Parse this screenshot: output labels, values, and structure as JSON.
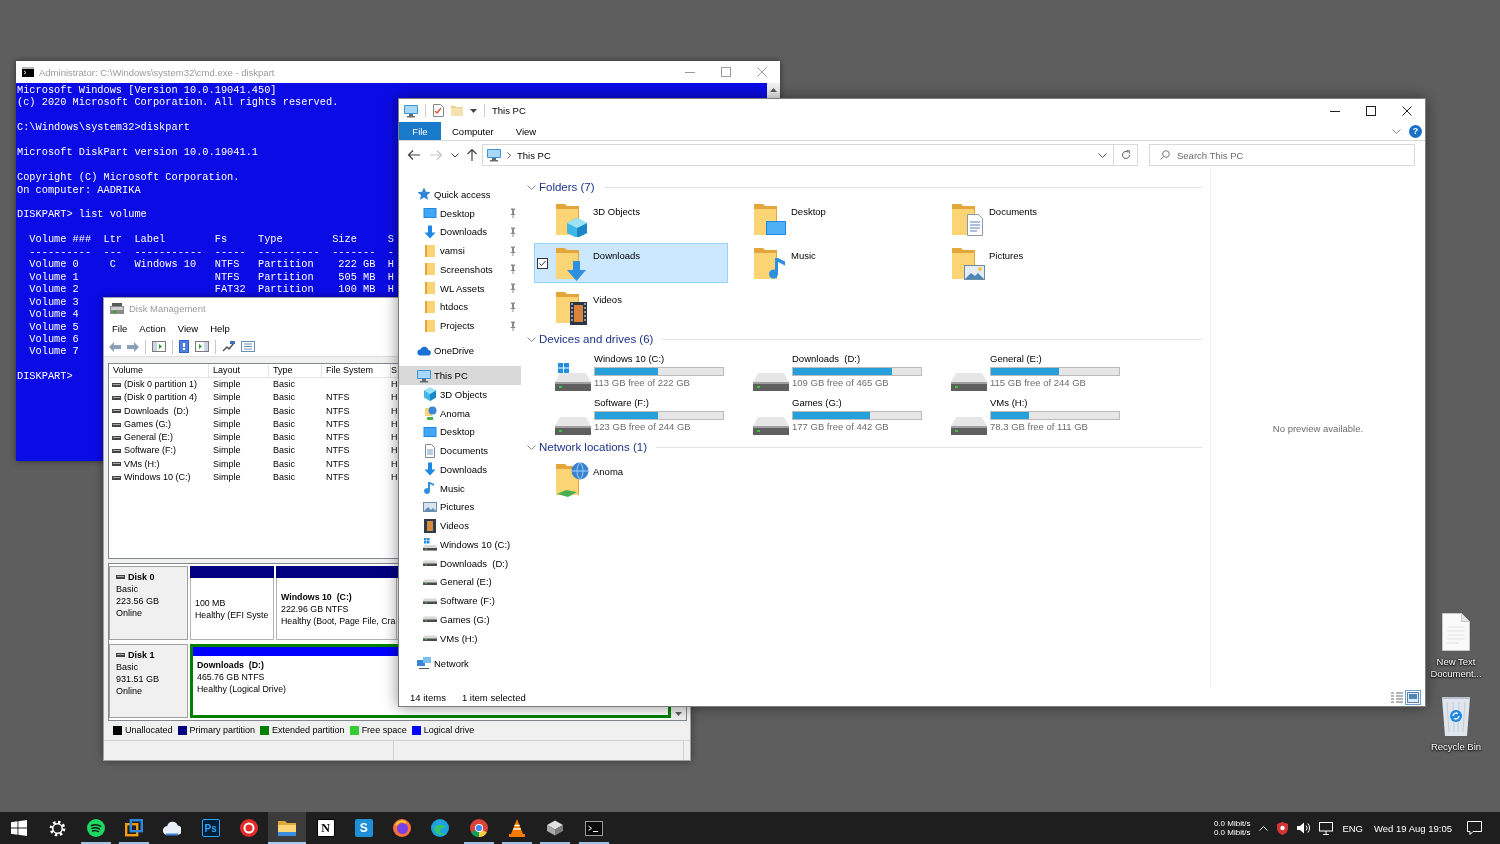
{
  "desktop": {
    "icons": [
      {
        "kind": "text-file",
        "label": "New Text Document..."
      },
      {
        "kind": "recycle-bin",
        "label": "Recycle Bin"
      }
    ]
  },
  "console_window": {
    "title": "Administrator: C:\\Windows\\system32\\cmd.exe - diskpart",
    "blocks": [
      [
        "Microsoft Windows [Version 10.0.19041.450]",
        "(c) 2020 Microsoft Corporation. All rights reserved."
      ],
      [
        "C:\\Windows\\system32>diskpart"
      ],
      [
        "Microsoft DiskPart version 10.0.19041.1"
      ],
      [
        "Copyright (C) Microsoft Corporation.",
        "On computer: AADRIKA"
      ],
      [
        "DISKPART> list volume"
      ],
      [
        "  Volume ###  Ltr  Label        Fs     Type        Size     S",
        "  ----------  ---  -----------  -----  ----------  -------  -",
        "  Volume 0     C   Windows 10   NTFS   Partition    222 GB  H",
        "  Volume 1                      NTFS   Partition    505 MB  H",
        "  Volume 2                      FAT32  Partition    100 MB  H",
        "  Volume 3",
        "  Volume 4",
        "  Volume 5",
        "  Volume 6",
        "  Volume 7"
      ],
      [
        "DISKPART>"
      ]
    ]
  },
  "disk_management": {
    "title": "Disk Management",
    "menu": [
      "File",
      "Action",
      "View",
      "Help"
    ],
    "volumes": {
      "columns": [
        "Volume",
        "Layout",
        "Type",
        "File System",
        "S"
      ],
      "rows": [
        {
          "volume": "(Disk 0 partition 1)",
          "layout": "Simple",
          "type": "Basic",
          "column_5": "H"
        },
        {
          "volume": "(Disk 0 partition 4)",
          "layout": "Simple",
          "type": "Basic",
          "file_system": "NTFS",
          "column_5": "H"
        },
        {
          "volume": "Downloads  (D:)",
          "layout": "Simple",
          "type": "Basic",
          "file_system": "NTFS",
          "column_5": "H"
        },
        {
          "volume": "Games (G:)",
          "layout": "Simple",
          "type": "Basic",
          "file_system": "NTFS",
          "column_5": "H"
        },
        {
          "volume": "General (E:)",
          "layout": "Simple",
          "type": "Basic",
          "file_system": "NTFS",
          "column_5": "H"
        },
        {
          "volume": "Software (F:)",
          "layout": "Simple",
          "type": "Basic",
          "file_system": "NTFS",
          "column_5": "H"
        },
        {
          "volume": "VMs (H:)",
          "layout": "Simple",
          "type": "Basic",
          "file_system": "NTFS",
          "column_5": "H"
        },
        {
          "volume": "Windows 10 (C:)",
          "layout": "Simple",
          "type": "Basic",
          "file_system": "NTFS",
          "column_5": "H"
        }
      ]
    },
    "disks": [
      {
        "name": "Disk 0",
        "type": "Basic",
        "size": "223.56 GB",
        "status": "Online",
        "partitions": [
          {
            "kind": "primary",
            "size": "100 MB",
            "status": "Healthy (EFI Syste"
          },
          {
            "kind": "primary",
            "name": "Windows 10  (C:)",
            "size": "222.96 GB NTFS",
            "status": "Healthy (Boot, Page File, Cra"
          }
        ]
      },
      {
        "name": "Disk 1",
        "type": "Basic",
        "size": "931.51 GB",
        "status": "Online",
        "partitions": [
          {
            "kind": "logical",
            "name": "Downloads  (D:)",
            "size": "465.76 GB NTFS",
            "status": "Healthy (Logical Drive)"
          }
        ]
      }
    ],
    "legend": [
      {
        "label": "Unallocated",
        "color": "#000000"
      },
      {
        "label": "Primary partition",
        "color": "#000080"
      },
      {
        "label": "Extended partition",
        "color": "#008000"
      },
      {
        "label": "Free space",
        "color": "#33cc33"
      },
      {
        "label": "Logical drive",
        "color": "#0000ff"
      }
    ]
  },
  "explorer": {
    "title": "This PC",
    "ribbon_tabs": [
      {
        "label": "File",
        "kind": "menu"
      },
      {
        "label": "Computer",
        "kind": "tab"
      },
      {
        "label": "View",
        "kind": "tab"
      }
    ],
    "help": "?",
    "nav_buttons": [
      {
        "kind": "back",
        "disabled": false
      },
      {
        "kind": "forward",
        "disabled": true
      },
      {
        "kind": "recent",
        "disabled": false
      },
      {
        "kind": "up",
        "disabled": false
      }
    ],
    "address": {
      "crumbs": [
        "This PC"
      ]
    },
    "search": {
      "placeholder": "Search This PC"
    },
    "nav_pane": [
      {
        "label": "Quick access",
        "kind": "star",
        "selected": false,
        "children": [
          {
            "label": "Desktop",
            "kind": "desktop",
            "pinned": true,
            "selected": false
          },
          {
            "label": "Downloads",
            "kind": "download",
            "pinned": true,
            "selected": false
          },
          {
            "label": "vamsi",
            "kind": "folder",
            "pinned": true,
            "selected": false
          },
          {
            "label": "Screenshots",
            "kind": "folder",
            "pinned": true,
            "selected": false
          },
          {
            "label": "WL Assets",
            "kind": "folder",
            "pinned": true,
            "selected": false
          },
          {
            "label": "htdocs",
            "kind": "folder",
            "pinned": true,
            "selected": false
          },
          {
            "label": "Projects",
            "kind": "folder",
            "pinned": true,
            "selected": false
          }
        ]
      },
      {
        "label": "OneDrive",
        "kind": "cloud",
        "selected": false
      },
      {
        "label": "This PC",
        "kind": "pc",
        "selected": true,
        "children": [
          {
            "label": "3D Objects",
            "kind": "cube",
            "selected": false
          },
          {
            "label": "Anoma",
            "kind": "network-folder",
            "selected": false
          },
          {
            "label": "Desktop",
            "kind": "desktop",
            "selected": false
          },
          {
            "label": "Documents",
            "kind": "documents",
            "selected": false
          },
          {
            "label": "Downloads",
            "kind": "download",
            "selected": false
          },
          {
            "label": "Music",
            "kind": "music",
            "selected": false
          },
          {
            "label": "Pictures",
            "kind": "pictures",
            "selected": false
          },
          {
            "label": "Videos",
            "kind": "videos",
            "selected": false
          },
          {
            "label": "Windows 10 (C:)",
            "kind": "system-drive",
            "selected": false
          },
          {
            "label": "Downloads  (D:)",
            "kind": "drive",
            "selected": false
          },
          {
            "label": "General (E:)",
            "kind": "drive",
            "selected": false
          },
          {
            "label": "Software (F:)",
            "kind": "drive",
            "selected": false
          },
          {
            "label": "Games (G:)",
            "kind": "drive",
            "selected": false
          },
          {
            "label": "VMs (H:)",
            "kind": "drive",
            "selected": false
          }
        ]
      },
      {
        "label": "Network",
        "kind": "network",
        "selected": false
      }
    ],
    "groups": [
      {
        "title": "Folders (7)",
        "kind": "folders",
        "expanded": true,
        "items": [
          {
            "label": "3D Objects",
            "kind": "cube",
            "selected": false
          },
          {
            "label": "Desktop",
            "kind": "screen",
            "selected": false
          },
          {
            "label": "Documents",
            "kind": "document",
            "selected": false
          },
          {
            "label": "Downloads",
            "kind": "arrow",
            "selected": true
          },
          {
            "label": "Music",
            "kind": "note",
            "selected": false
          },
          {
            "label": "Pictures",
            "kind": "picture",
            "selected": false
          },
          {
            "label": "Videos",
            "kind": "film",
            "selected": false
          }
        ]
      },
      {
        "title": "Devices and drives (6)",
        "kind": "drives",
        "expanded": true,
        "items": [
          {
            "label": "Windows 10 (C:)",
            "kind": "system",
            "level": 0.49,
            "free": "113 GB free of 222 GB"
          },
          {
            "label": "Downloads  (D:)",
            "kind": "disk",
            "level": 0.77,
            "free": "109 GB free of 465 GB"
          },
          {
            "label": "General (E:)",
            "kind": "disk",
            "level": 0.53,
            "free": "115 GB free of 244 GB"
          },
          {
            "label": "Software (F:)",
            "kind": "disk",
            "level": 0.49,
            "free": "123 GB free of 244 GB"
          },
          {
            "label": "Games (G:)",
            "kind": "disk",
            "level": 0.6,
            "free": "177 GB free of 442 GB"
          },
          {
            "label": "VMs (H:)",
            "kind": "disk",
            "level": 0.3,
            "free": "78.3 GB free of 111 GB"
          }
        ]
      },
      {
        "title": "Network locations (1)",
        "kind": "folders",
        "expanded": true,
        "items": [
          {
            "label": "Anoma",
            "kind": "globe",
            "selected": false
          }
        ]
      }
    ],
    "preview": "No preview available.",
    "status": [
      "14 items",
      "1 item selected"
    ],
    "views": [
      {
        "kind": "details",
        "selected": false
      },
      {
        "kind": "tiles",
        "selected": true
      }
    ]
  },
  "taskbar": {
    "apps": [
      {
        "kind": "start",
        "running": false,
        "selected": false
      },
      {
        "kind": "gear",
        "running": false,
        "selected": false
      },
      {
        "kind": "waves",
        "running": true,
        "selected": false
      },
      {
        "kind": "frames",
        "running": true,
        "selected": false
      },
      {
        "kind": "cloud",
        "running": false,
        "selected": false
      },
      {
        "kind": "letter-dark",
        "glyph": "Ps",
        "running": false,
        "selected": false
      },
      {
        "kind": "ring",
        "running": false,
        "selected": false
      },
      {
        "kind": "folder",
        "running": true,
        "selected": true
      },
      {
        "kind": "letter-light",
        "glyph": "N",
        "running": false,
        "selected": false
      },
      {
        "kind": "letter-blue",
        "glyph": "S",
        "running": false,
        "selected": false
      },
      {
        "kind": "fox",
        "running": false,
        "selected": false
      },
      {
        "kind": "swirl",
        "running": false,
        "selected": false
      },
      {
        "kind": "segments",
        "running": true,
        "selected": false
      },
      {
        "kind": "cone",
        "running": true,
        "selected": false
      },
      {
        "kind": "boxes",
        "running": true,
        "selected": false
      },
      {
        "kind": "terminal",
        "running": true,
        "selected": false
      }
    ],
    "tray": {
      "network_speed": [
        "0.0 Mibit/s",
        "0.0 Mibit/s"
      ],
      "language": "ENG",
      "clock": "Wed 19 Aug 19:05"
    }
  }
}
